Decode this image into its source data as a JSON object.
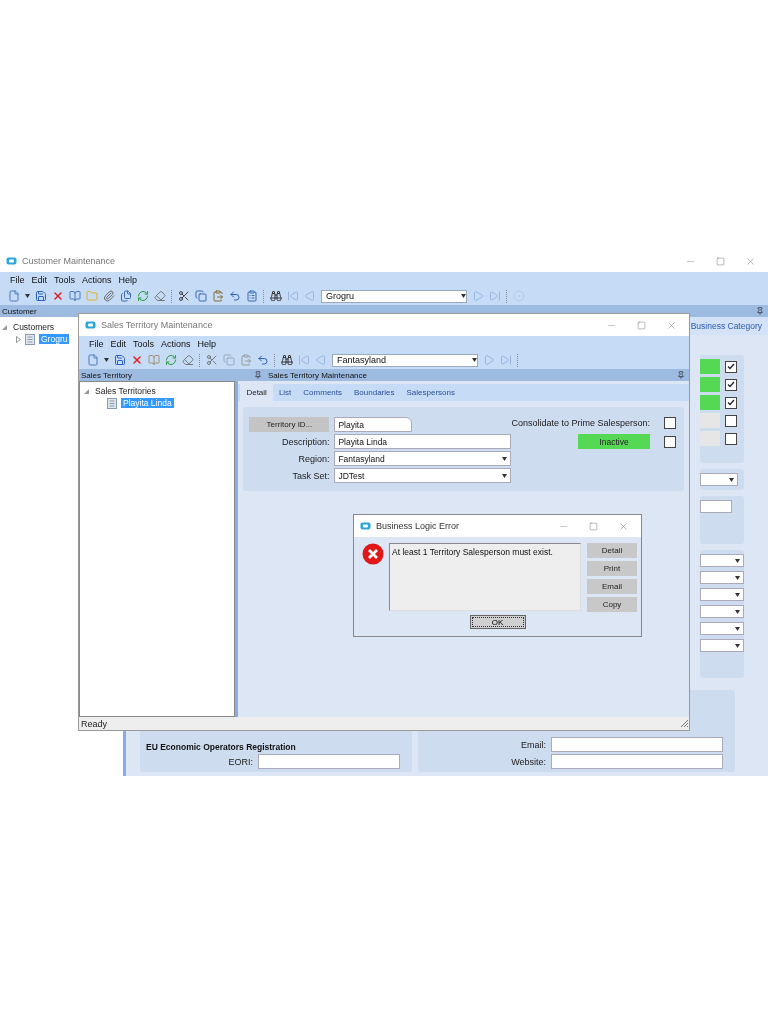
{
  "main_window": {
    "title": "Customer Maintenance",
    "menu": [
      "File",
      "Edit",
      "Tools",
      "Actions",
      "Help"
    ],
    "toolbar": {
      "record_combo": "Grogru"
    },
    "left_pane": {
      "header": "Customer",
      "tree": [
        {
          "label": "Customers",
          "expanded": true,
          "children": [
            {
              "label": "Grogru",
              "expanded": false,
              "selected": true
            }
          ]
        }
      ]
    },
    "tabs": [
      {
        "label": "Business Category",
        "selected": false
      }
    ],
    "flags": [
      {
        "color": "#55d955",
        "checked": true
      },
      {
        "color": "#55d955",
        "checked": true
      },
      {
        "color": "#55d955",
        "checked": true
      },
      {
        "color": "#e6e6e6",
        "checked": false
      },
      {
        "color": "#e6e6e6",
        "checked": false
      }
    ],
    "eu_section": {
      "title": "EU Economic Operators Registration",
      "fields": [
        {
          "label": "EORI:"
        }
      ]
    },
    "contact_fields": [
      {
        "label": "Email:"
      },
      {
        "label": "Website:"
      }
    ]
  },
  "territory_window": {
    "title": "Sales Territory Maintenance",
    "menu": [
      "File",
      "Edit",
      "Tools",
      "Actions",
      "Help"
    ],
    "toolbar": {
      "record_combo": "Fantasyland"
    },
    "left_pane": {
      "header": "Sales Territory",
      "tree": [
        {
          "label": "Sales Territories",
          "expanded": true,
          "children": [
            {
              "label": "Playita Linda",
              "selected": true
            }
          ]
        }
      ]
    },
    "right_pane": {
      "header": "Sales Territory Maintenance",
      "tabs": [
        {
          "label": "Detail",
          "selected": true
        },
        {
          "label": "List",
          "selected": false
        },
        {
          "label": "Comments",
          "selected": false
        },
        {
          "label": "Boundaries",
          "selected": false
        },
        {
          "label": "Salespersons",
          "selected": false
        }
      ],
      "fields": [
        {
          "kind": "lookup",
          "label": "Territory ID...",
          "value": "Playita"
        },
        {
          "kind": "text",
          "label": "Description:",
          "value": "Playita Linda"
        },
        {
          "kind": "dropdown",
          "label": "Region:",
          "value": "Fantasyland"
        },
        {
          "kind": "dropdown",
          "label": "Task Set:",
          "value": "JDTest"
        }
      ],
      "consolidate": {
        "label": "Consolidate to Prime Salesperson:",
        "checked": false
      },
      "status_toggle": {
        "label": "Inactive",
        "checked": false
      }
    },
    "status_bar": "Ready"
  },
  "error_dialog": {
    "title": "Business Logic Error",
    "message": "At least 1 Territory Salesperson must exist.",
    "side_buttons": [
      "Detail",
      "Print",
      "Email",
      "Copy"
    ],
    "ok_button": "OK"
  }
}
